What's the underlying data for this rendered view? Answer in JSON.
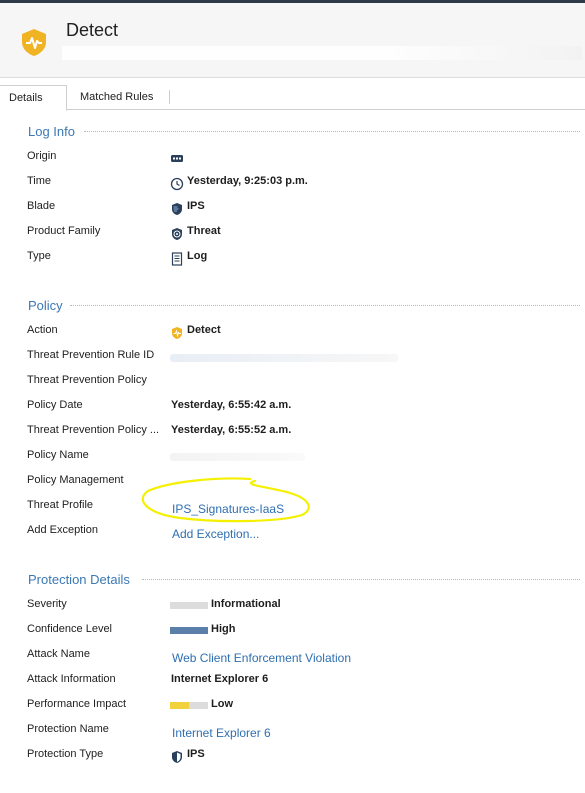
{
  "header": {
    "title": "Detect"
  },
  "tabs": [
    {
      "label": "Details",
      "active": true
    },
    {
      "label": "Matched Rules",
      "active": false
    }
  ],
  "log_info": {
    "title": "Log Info",
    "rows": [
      {
        "label": "Origin",
        "value": "",
        "icon": "gateway-icon"
      },
      {
        "label": "Time",
        "value": "Yesterday, 9:25:03 p.m.",
        "icon": "clock-icon"
      },
      {
        "label": "Blade",
        "value": "IPS",
        "icon": "ips-shield-icon"
      },
      {
        "label": "Product Family",
        "value": "Threat",
        "icon": "threat-icon"
      },
      {
        "label": "Type",
        "value": "Log",
        "icon": "log-icon"
      }
    ]
  },
  "policy": {
    "title": "Policy",
    "rows": [
      {
        "label": "Action",
        "value": "Detect",
        "icon": "detect-icon"
      },
      {
        "label": "Threat Prevention Rule ID",
        "value": ""
      },
      {
        "label": "Threat Prevention Policy",
        "value": ""
      },
      {
        "label": "Policy Date",
        "value": "Yesterday, 6:55:42 a.m."
      },
      {
        "label": "Threat Prevention Policy ...",
        "value": "Yesterday, 6:55:52 a.m."
      },
      {
        "label": "Policy Name",
        "value": ""
      },
      {
        "label": "Policy Management",
        "value": ""
      },
      {
        "label": "Threat Profile",
        "link": "IPS_Signatures-IaaS"
      },
      {
        "label": "Add Exception",
        "link": "Add Exception..."
      }
    ]
  },
  "protection_details": {
    "title": "Protection Details",
    "rows": [
      {
        "label": "Severity",
        "value": "Informational",
        "level": 0.0
      },
      {
        "label": "Confidence Level",
        "value": "High",
        "level": 1.0
      },
      {
        "label": "Attack Name",
        "link": "Web Client Enforcement Violation"
      },
      {
        "label": "Attack Information",
        "value": "Internet Explorer 6"
      },
      {
        "label": "Performance Impact",
        "value": "Low",
        "level": 0.5
      },
      {
        "label": "Protection Name",
        "link": "Internet Explorer 6"
      },
      {
        "label": "Protection Type",
        "value": "IPS",
        "icon": "ips-shield-icon"
      }
    ]
  },
  "colors": {
    "accent": "#3c78b4",
    "link": "#2e6fb0",
    "detect_orange": "#f0b323",
    "bar_blue": "#5a7fa8",
    "bar_yellow": "#f2d23c",
    "bar_gray": "#dcdcdc",
    "highlight": "#f5f000"
  }
}
